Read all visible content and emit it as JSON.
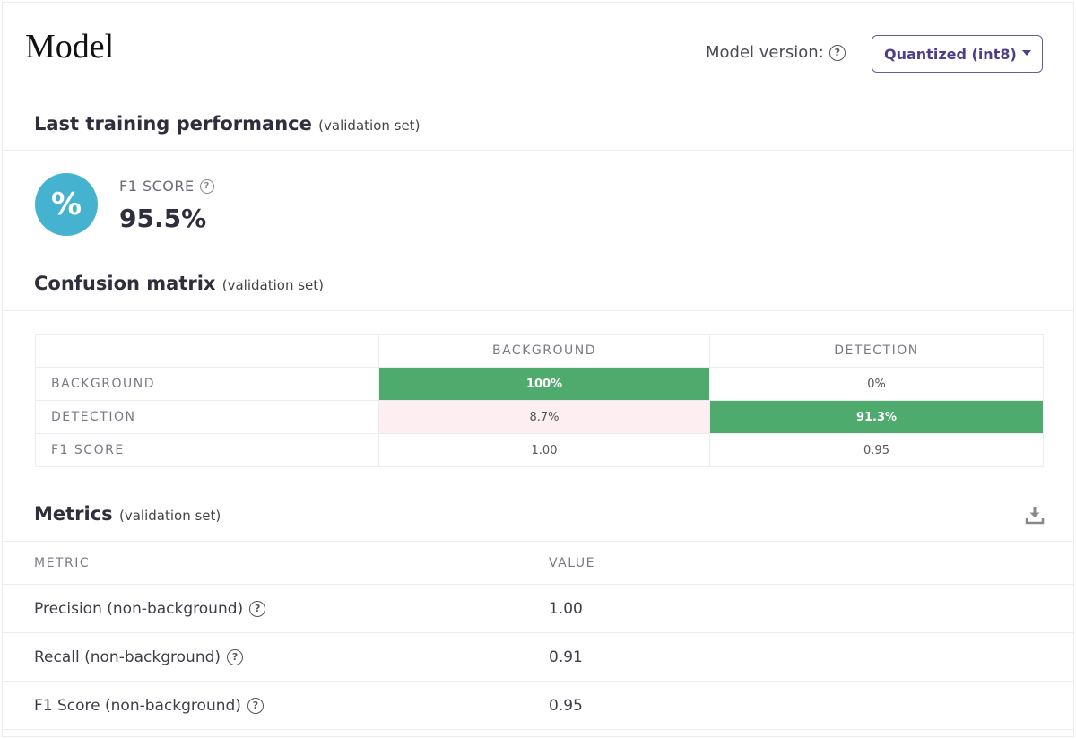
{
  "page": {
    "title": "Model"
  },
  "model_version": {
    "label": "Model version:",
    "selected": "Quantized (int8)",
    "help_icon": "question-circle-icon"
  },
  "training": {
    "title": "Last training performance",
    "subtitle": "(validation set)",
    "f1_icon": "%",
    "f1_label": "F1 SCORE",
    "f1_value": "95.5%",
    "accent": "#45b2d0"
  },
  "confusion": {
    "title": "Confusion matrix",
    "subtitle": "(validation set)",
    "columns": [
      "BACKGROUND",
      "DETECTION"
    ],
    "rows": [
      {
        "label": "BACKGROUND",
        "cells": [
          "100%",
          "0%"
        ]
      },
      {
        "label": "DETECTION",
        "cells": [
          "8.7%",
          "91.3%"
        ]
      },
      {
        "label": "F1 SCORE",
        "cells": [
          "1.00",
          "0.95"
        ]
      }
    ],
    "good_color": "#4faa6e",
    "bad_color": "#fdeef2"
  },
  "metrics": {
    "title": "Metrics",
    "subtitle": "(validation set)",
    "download_icon": "download-icon",
    "headers": [
      "METRIC",
      "VALUE"
    ],
    "rows": [
      {
        "name": "Precision (non-background)",
        "value": "1.00"
      },
      {
        "name": "Recall (non-background)",
        "value": "0.91"
      },
      {
        "name": "F1 Score (non-background)",
        "value": "0.95"
      }
    ]
  }
}
